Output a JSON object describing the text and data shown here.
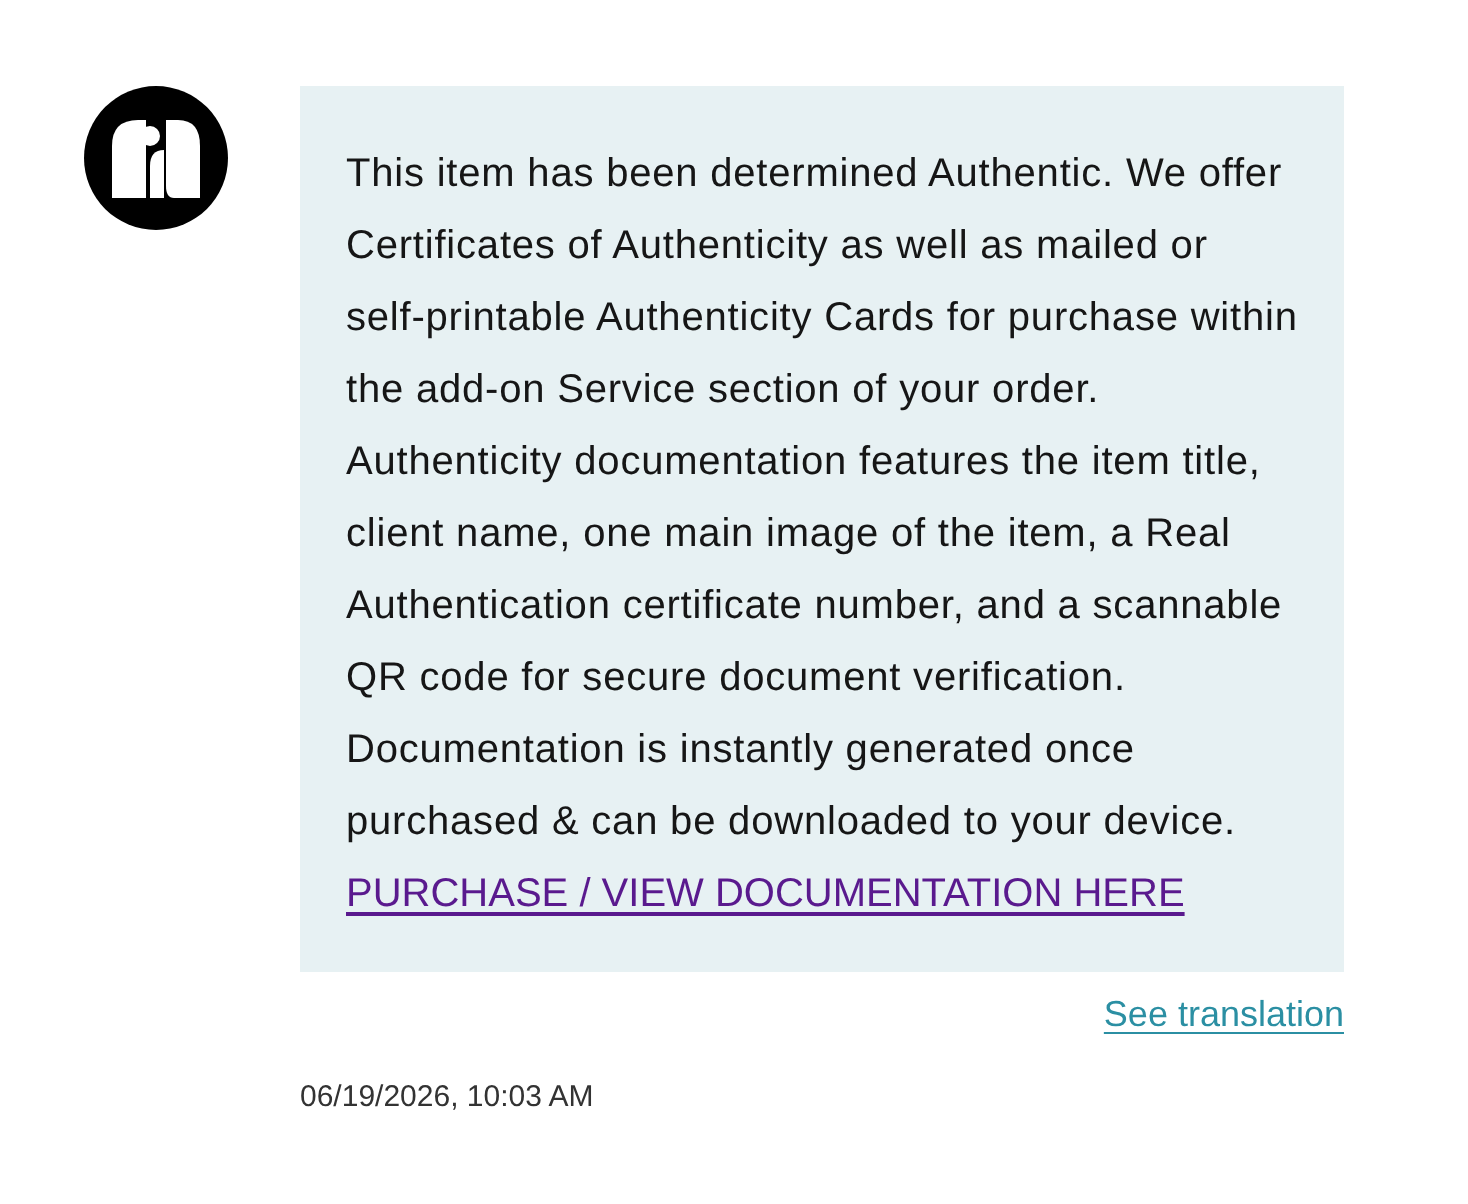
{
  "message": {
    "text": "This item has been determined Authentic. We offer Certificates of Authenticity as well as mailed or self-printable Authenticity Cards for purchase within the add-on Service section of your order. Authenticity documentation features the item title, client name, one main image of the item, a Real Authentication certificate number, and a scannable QR code for secure document verification. Documentation is instantly generated once purchased & can be downloaded to your device.",
    "link": {
      "label": "PURCHASE / VIEW DOCUMENTATION HERE",
      "visited": true
    }
  },
  "translation_link": "See translation",
  "timestamp": "06/19/2026, 10:03 AM"
}
